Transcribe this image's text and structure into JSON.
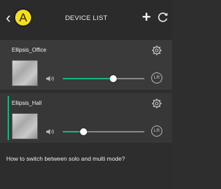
{
  "header": {
    "title": "DEVICE LIST",
    "back_glyph": "‹",
    "marker_label": "A",
    "add_glyph": "+"
  },
  "devices": [
    {
      "name": "Ellipsis_Office",
      "volume": 0.62,
      "channel_label": "LR"
    },
    {
      "name": "Ellipsis_Hall",
      "volume": 0.25,
      "channel_label": "LR",
      "selected": true
    }
  ],
  "help": {
    "text": "How to switch between solo and multi mode?"
  },
  "colors": {
    "accent": "#19b37a",
    "marker": "#f5df17"
  },
  "icons": [
    "chevron-left-icon",
    "plus-icon",
    "refresh-icon",
    "gear-icon",
    "speaker-icon",
    "stereo-lr-icon"
  ]
}
